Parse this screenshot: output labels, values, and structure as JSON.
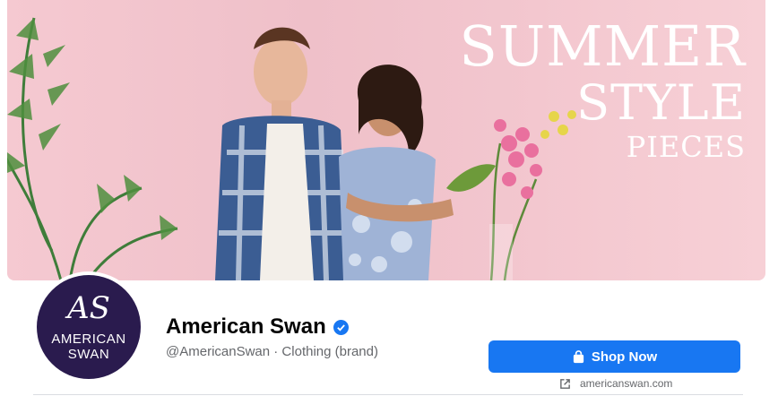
{
  "cover": {
    "headline_line1": "SUMMER",
    "headline_line2": "STYLE",
    "headline_line3": "PIECES",
    "bg_color": "#f2c5cd"
  },
  "profile": {
    "logo_mark": "AS",
    "logo_line1": "AMERICAN",
    "logo_line2": "SWAN",
    "logo_bg": "#2a1b4e"
  },
  "page": {
    "name": "American Swan",
    "verified_icon": "verified-badge-icon",
    "meta": "@AmericanSwan · Clothing (brand)"
  },
  "actions": {
    "shop_label": "Shop Now",
    "shop_icon": "shopping-bag-icon",
    "accent": "#1877f2",
    "website": "americanswan.com",
    "website_icon": "external-link-icon"
  }
}
